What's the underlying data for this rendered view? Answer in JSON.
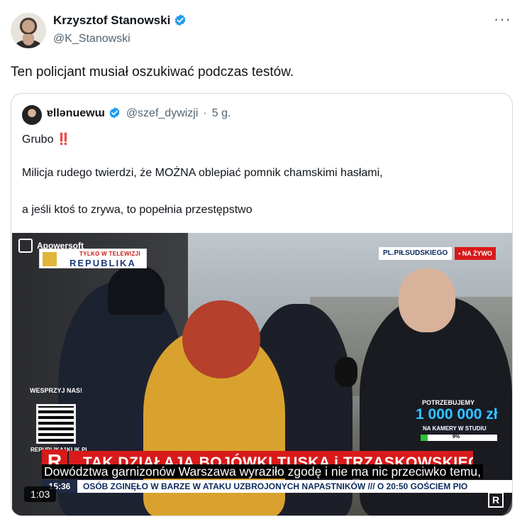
{
  "author": {
    "name": "Krzysztof Stanowski",
    "handle": "@K_Stanowski"
  },
  "tweet": {
    "text": "Ten policjant musiał oszukiwać podczas testów."
  },
  "icons": {
    "verified": "verified-badge-icon",
    "more": "more-options-icon"
  },
  "more_glyph": "···",
  "quoted": {
    "name": "ɐllənuewɯ",
    "handle": "@szef_dywizji",
    "separator": "·",
    "time": "5 g.",
    "line1": "Grubo ‼️",
    "line2": "Milicja rudego twierdzi, że MOŻNA oblepiać pomnik chamskimi hasłami,",
    "line3": "a jeśli ktoś to zrywa, to popełnia przestępstwo"
  },
  "video": {
    "watermark": "Apowersoft",
    "channel_small": "TYLKO W TELEWIZJI",
    "channel_big": "REPUBLIKA",
    "location": "PL.PIŁSUDSKIEGO",
    "live": "• NA ŻYWO",
    "support": "WESPRZYJ NAS!",
    "support_url": "REPUBLIKA1KLIK.PL",
    "fund_label": "POTRZEBUJEMY",
    "fund_amount": "1 000 000 zł",
    "fund_sub": "NA KAMERY W STUDIU",
    "fund_percent_label": "9%",
    "fund_fraction": 0.09,
    "banner_logo": "R",
    "banner": "TAK DZIAŁAJĄ BOJÓWKI TUSKA i TRZASKOWSKIEGO",
    "subtitle": "Dowództwa garnizonów Warszawa wyraziło zgodę i nie ma nic przeciwko temu,",
    "clock": "15:36",
    "ticker": "OSÓB ZGINĘŁO W BARZE W ATAKU UZBROJONYCH NAPASTNIKÓW /// O 20:50 GOŚCIEM PIO",
    "duration": "1:03",
    "corner_logo": "R"
  },
  "colors": {
    "verified": "#1d9bf0",
    "republika_red": "#d81a1a",
    "fund_blue": "#35c4ff"
  }
}
